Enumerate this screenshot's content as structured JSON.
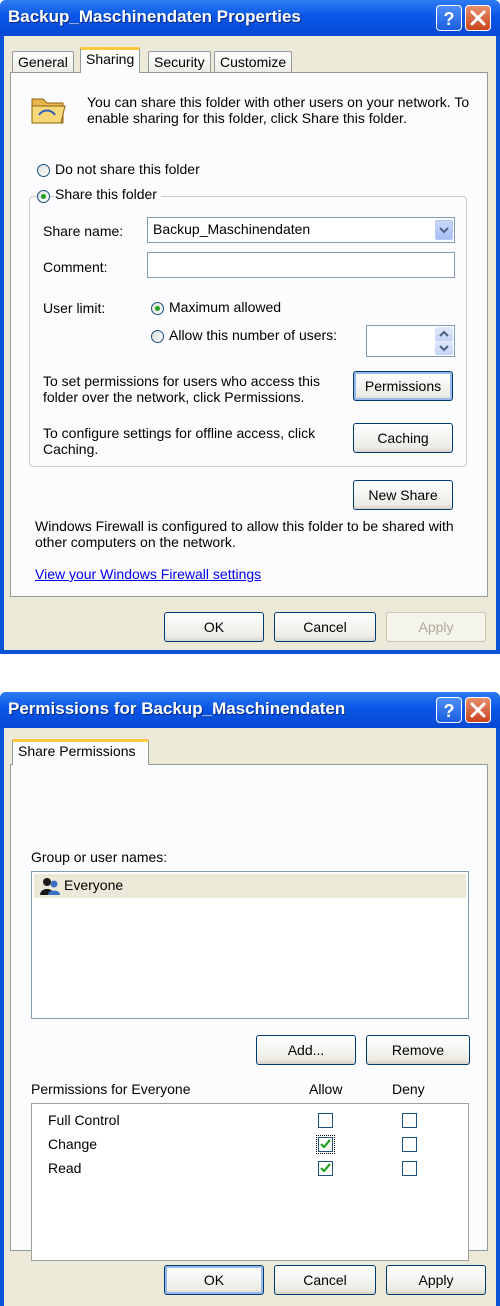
{
  "props": {
    "title": "Backup_Maschinendaten Properties",
    "tabs": [
      "General",
      "Sharing",
      "Security",
      "Customize"
    ],
    "active_tab": "Sharing",
    "info_text": "You can share this folder with other users on your network.  To enable sharing for this folder, click Share this folder.",
    "radio_not_share": "Do not share this folder",
    "radio_share": "Share this folder",
    "share_name_label": "Share name:",
    "share_name_value": "Backup_Maschinendaten",
    "comment_label": "Comment:",
    "comment_value": "",
    "user_limit_label": "User limit:",
    "max_allowed": "Maximum allowed",
    "allow_number": "Allow this number of users:",
    "allow_number_value": "",
    "permissions_text": "To set permissions for users who access this folder over the network, click Permissions.",
    "permissions_button": "Permissions",
    "caching_text": "To configure settings for offline access, click Caching.",
    "caching_button": "Caching",
    "new_share_button": "New Share",
    "firewall_text": "Windows Firewall is configured to allow this folder to be shared with other computers on the network.",
    "firewall_link": "View your Windows Firewall settings",
    "ok": "OK",
    "cancel": "Cancel",
    "apply": "Apply"
  },
  "perms": {
    "title": "Permissions for Backup_Maschinendaten",
    "tab": "Share Permissions",
    "group_label": "Group or user names:",
    "users": [
      "Everyone"
    ],
    "add_button": "Add...",
    "remove_button": "Remove",
    "perm_header": "Permissions for Everyone",
    "allow_header": "Allow",
    "deny_header": "Deny",
    "rows": [
      {
        "label": "Full Control",
        "allow": false,
        "deny": false
      },
      {
        "label": "Change",
        "allow": true,
        "deny": false
      },
      {
        "label": "Read",
        "allow": true,
        "deny": false
      }
    ],
    "ok": "OK",
    "cancel": "Cancel",
    "apply": "Apply"
  },
  "icons": {
    "help": "help-icon",
    "close": "close-icon",
    "folder": "shared-folder-icon",
    "users": "users-group-icon"
  },
  "colors": {
    "titlebar": "#0a56e6",
    "dialog_bg": "#ece9d8",
    "tab_highlight": "#ffc83c",
    "selected_row": "#ece9d8",
    "check": "#21a121"
  }
}
